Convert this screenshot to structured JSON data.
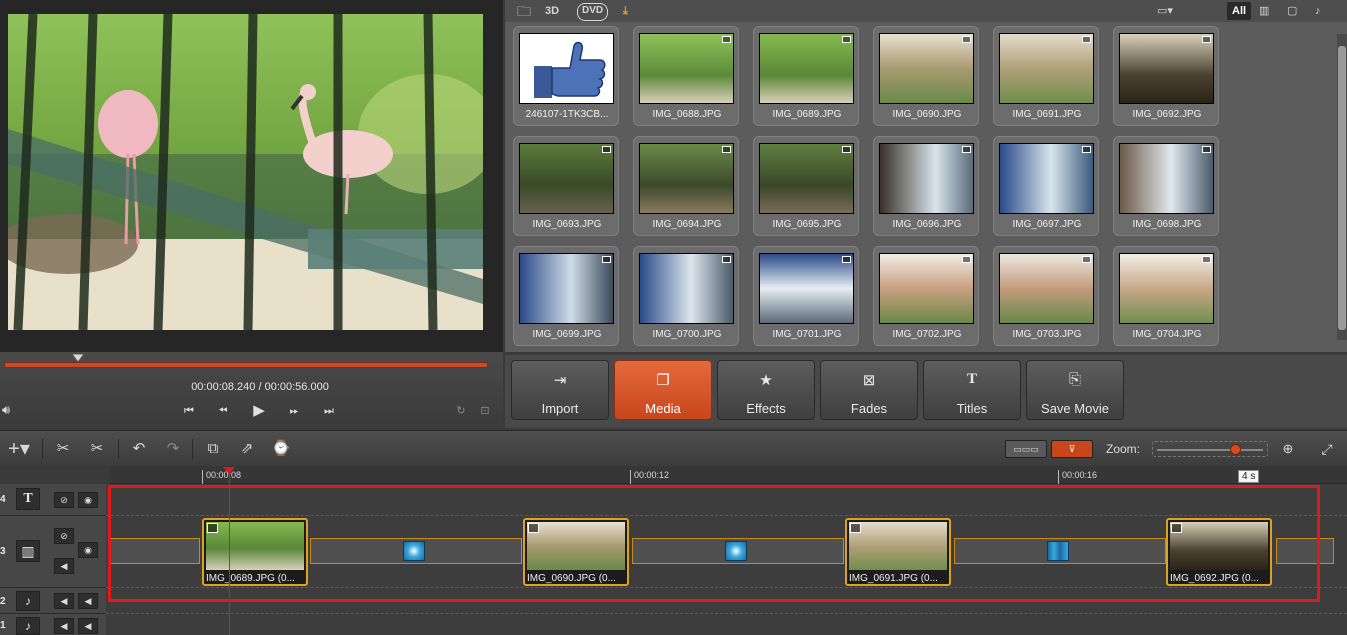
{
  "player": {
    "timecode": "00:00:08.240 / 00:00:56.000"
  },
  "media_toolbar": {
    "label_3d": "3D",
    "label_dvd": "DVD",
    "filter_all": "All"
  },
  "media_items": [
    {
      "name": "246107-1TK3CB..."
    },
    {
      "name": "IMG_0688.JPG"
    },
    {
      "name": "IMG_0689.JPG"
    },
    {
      "name": "IMG_0690.JPG"
    },
    {
      "name": "IMG_0691.JPG"
    },
    {
      "name": "IMG_0692.JPG"
    },
    {
      "name": "IMG_0693.JPG"
    },
    {
      "name": "IMG_0694.JPG"
    },
    {
      "name": "IMG_0695.JPG"
    },
    {
      "name": "IMG_0696.JPG"
    },
    {
      "name": "IMG_0697.JPG"
    },
    {
      "name": "IMG_0698.JPG"
    },
    {
      "name": "IMG_0699.JPG"
    },
    {
      "name": "IMG_0700.JPG"
    },
    {
      "name": "IMG_0701.JPG"
    },
    {
      "name": "IMG_0702.JPG"
    },
    {
      "name": "IMG_0703.JPG"
    },
    {
      "name": "IMG_0704.JPG"
    }
  ],
  "mode_tabs": [
    {
      "label": "Import",
      "icon": "import-icon"
    },
    {
      "label": "Media",
      "icon": "media-icon",
      "active": true
    },
    {
      "label": "Effects",
      "icon": "star-icon"
    },
    {
      "label": "Fades",
      "icon": "fades-icon"
    },
    {
      "label": "Titles",
      "icon": "titles-icon"
    },
    {
      "label": "Save Movie",
      "icon": "save-movie-icon"
    }
  ],
  "timeline_toolbar": {
    "zoom_label": "Zoom:",
    "zoom_tooltip": "4 s"
  },
  "ruler": {
    "ticks": [
      "00:00:08",
      "00:00:12",
      "00:00:16"
    ]
  },
  "tracks": {
    "numbers": [
      "4",
      "3",
      "2",
      "1"
    ]
  },
  "clips": [
    {
      "label": "IMG_0689.JPG (0..."
    },
    {
      "label": "IMG_0690.JPG (0..."
    },
    {
      "label": "IMG_0691.JPG (0..."
    },
    {
      "label": "IMG_0692.JPG (0..."
    }
  ],
  "colors": {
    "accent": "#d84a20",
    "selection": "#e01a1a",
    "clip_border": "#e0a020",
    "transition_blue": "#3ba8e0"
  }
}
